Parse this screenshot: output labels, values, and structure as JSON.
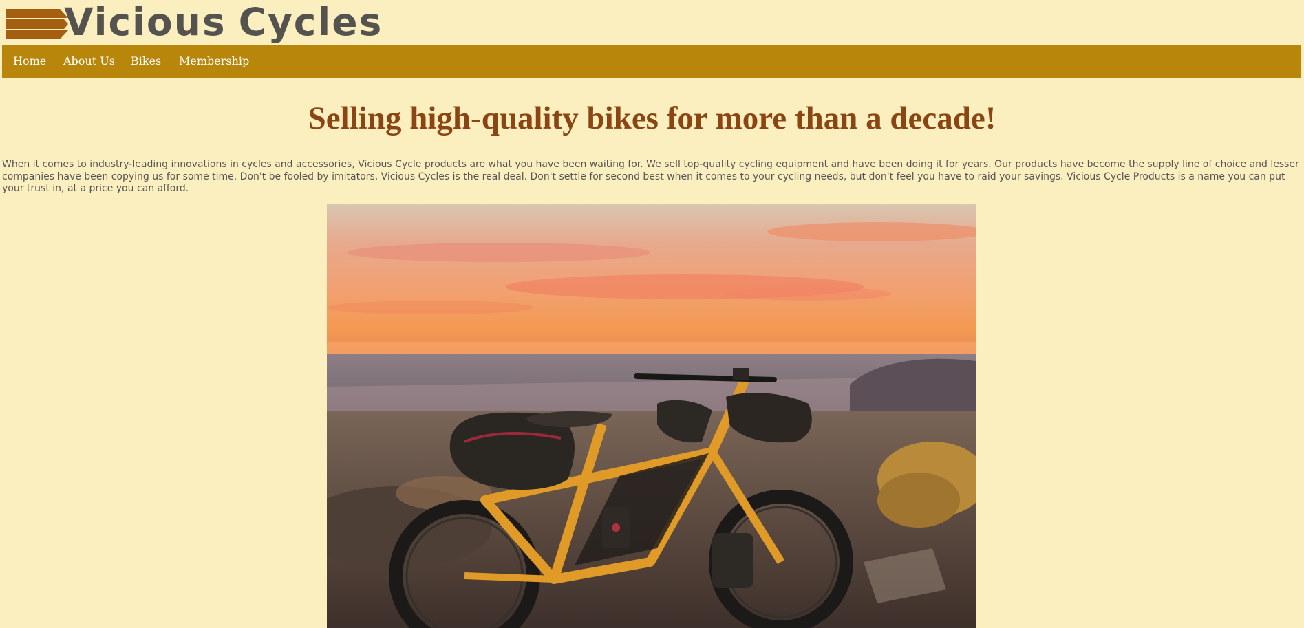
{
  "brand": {
    "name_part1": "Vicious",
    "name_part2": "Cycles",
    "bar_color": "#a45f10",
    "text_color": "#555350"
  },
  "nav": {
    "background": "#b8860b",
    "items": [
      {
        "label": "Home"
      },
      {
        "label": "About Us"
      },
      {
        "label": "Bikes"
      },
      {
        "label": "Membership"
      }
    ]
  },
  "main": {
    "headline": "Selling high-quality bikes for more than a decade!",
    "intro": "When it comes to industry-leading innovations in cycles and accessories, Vicious Cycle products are what you have been waiting for. We sell top-quality cycling equipment and have been doing it for years. Our products have become the supply line of choice and lesser companies have been copying us for some time. Don't be fooled by imitators, Vicious Cycles is the real deal. Don't settle for second best when it comes to your cycling needs, but don't feel you have to raid your savings. Vicious Cycle Products is a name you can put your trust in, at a price you can afford."
  },
  "colors": {
    "page_background": "#fcefbf",
    "headline": "#8b4513",
    "body_text": "#555555"
  }
}
